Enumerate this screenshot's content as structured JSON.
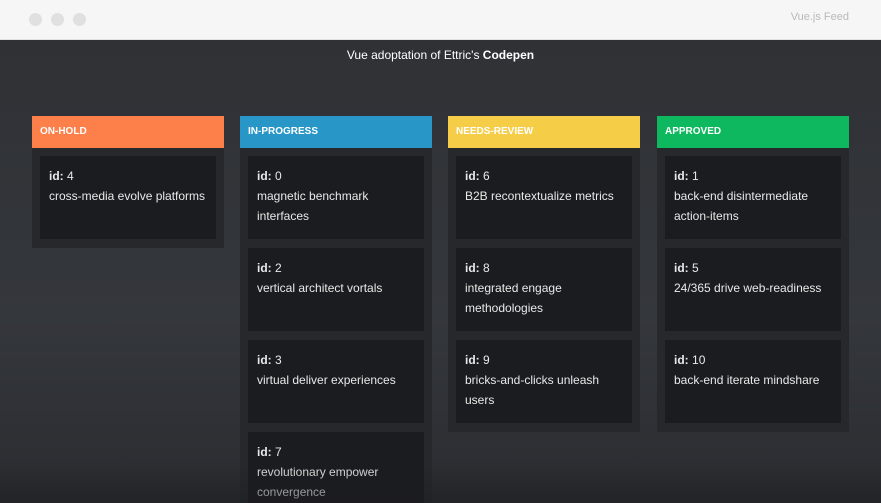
{
  "window": {
    "title": "Vue.js Feed"
  },
  "headline": {
    "prefix": "Vue adoptation of Ettric's ",
    "link": "Codepen"
  },
  "id_label": "id:",
  "columns": [
    {
      "title": "ON-HOLD",
      "color": "#fd7f4a",
      "cards": [
        {
          "id": "4",
          "text": "cross-media evolve platforms"
        }
      ]
    },
    {
      "title": "IN-PROGRESS",
      "color": "#2996c8",
      "cards": [
        {
          "id": "0",
          "text": "magnetic benchmark interfaces"
        },
        {
          "id": "2",
          "text": "vertical architect vortals"
        },
        {
          "id": "3",
          "text": "virtual deliver experiences"
        },
        {
          "id": "7",
          "text": "revolutionary empower convergence"
        }
      ]
    },
    {
      "title": "NEEDS-REVIEW",
      "color": "#f5cd47",
      "cards": [
        {
          "id": "6",
          "text": "B2B recontextualize metrics"
        },
        {
          "id": "8",
          "text": "integrated engage methodologies"
        },
        {
          "id": "9",
          "text": "bricks-and-clicks unleash users"
        }
      ]
    },
    {
      "title": "APPROVED",
      "color": "#0db85e",
      "cards": [
        {
          "id": "1",
          "text": "back-end disintermediate action-items"
        },
        {
          "id": "5",
          "text": "24/365 drive web-readiness"
        },
        {
          "id": "10",
          "text": "back-end iterate mindshare"
        }
      ]
    }
  ]
}
